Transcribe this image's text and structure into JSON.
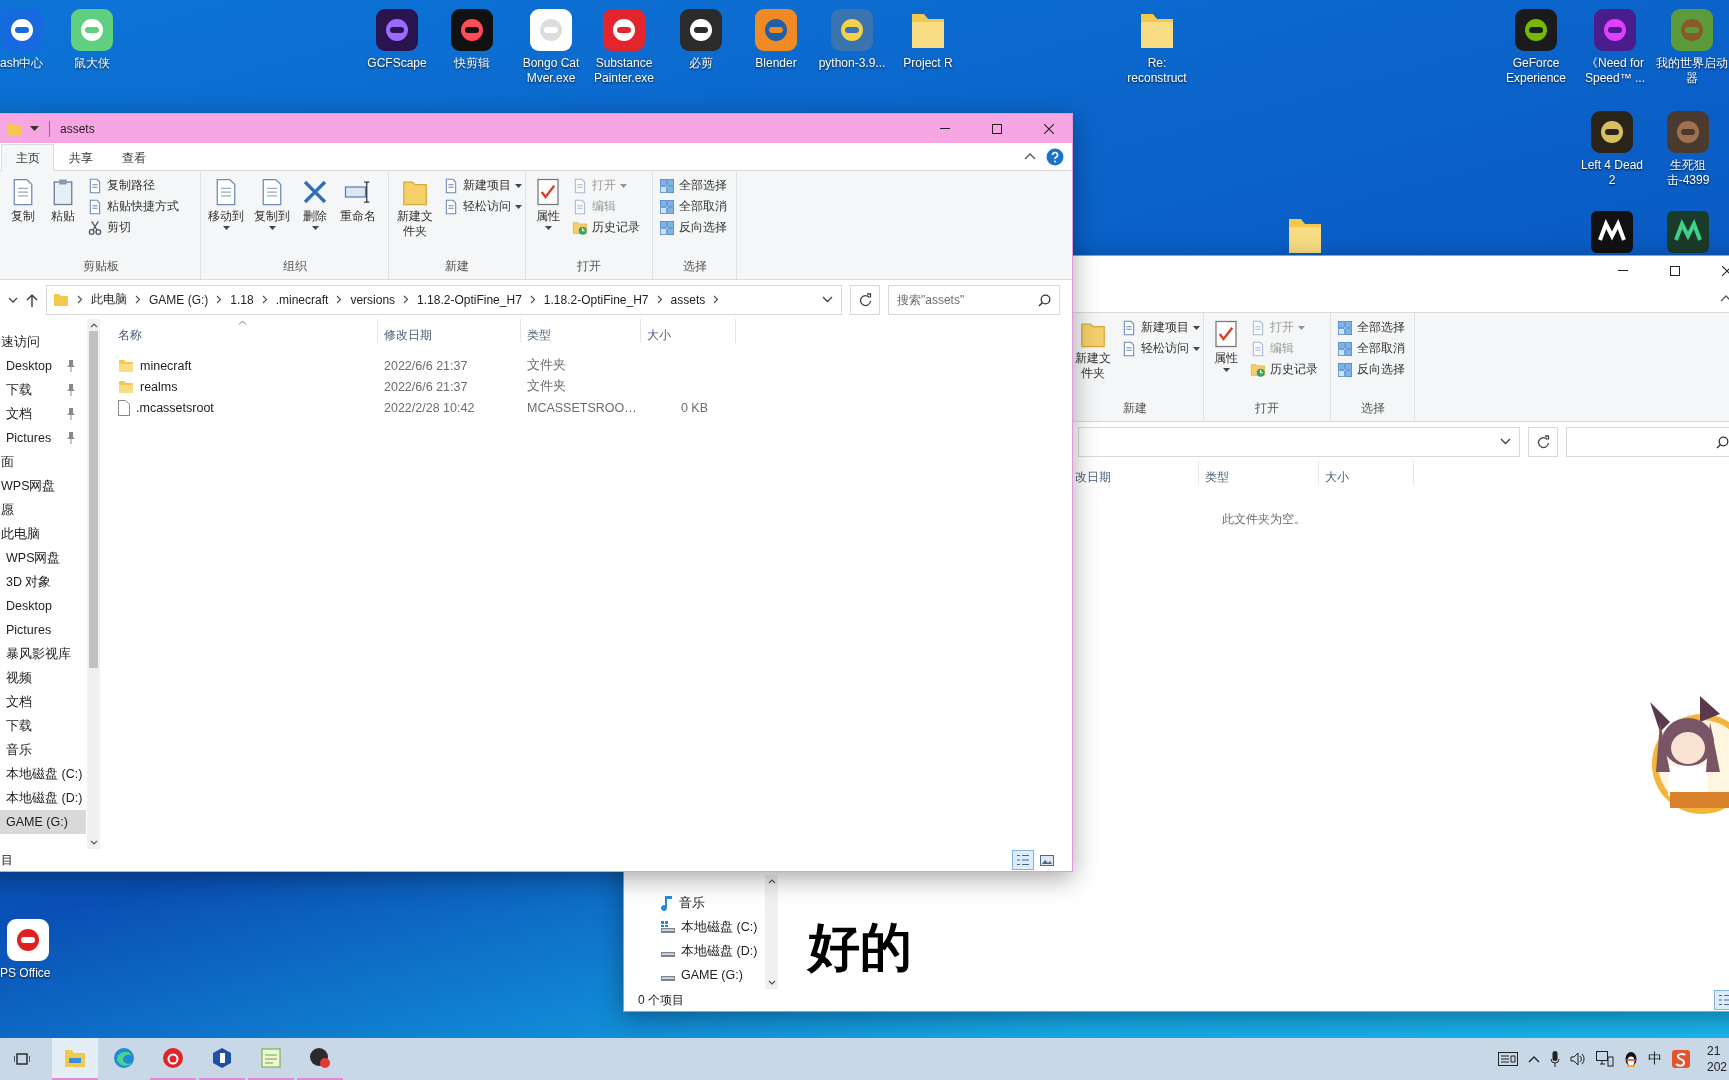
{
  "desktop_icons": [
    {
      "label": "ash中心"
    },
    {
      "label": "鼠大侠"
    },
    {
      "label": "GCFScape"
    },
    {
      "label": "快剪辑"
    },
    {
      "label": "Bongo Cat Mver.exe"
    },
    {
      "label": "Substance Painter.exe"
    },
    {
      "label": "必剪"
    },
    {
      "label": "Blender"
    },
    {
      "label": "python-3.9..."
    },
    {
      "label": "Project R"
    },
    {
      "label": "Re: reconstruct"
    },
    {
      "label": "GeForce Experience"
    },
    {
      "label": "《Need for Speed™ ..."
    },
    {
      "label": "我的世界启动器"
    },
    {
      "label": "Left 4 Dead 2"
    },
    {
      "label": "生死狙击-4399"
    },
    {
      "label": "PS Office"
    }
  ],
  "windows": [
    {
      "active": true,
      "title": "assets",
      "tabs": [
        {
          "label": "主页",
          "selected": true
        },
        {
          "label": "共享",
          "selected": false
        },
        {
          "label": "查看",
          "selected": false
        }
      ],
      "ribbon": [
        {
          "label": "剪贴板",
          "buttons": [
            {
              "kind": "large",
              "label": "复制",
              "caret": false,
              "disabled": false
            },
            {
              "kind": "large",
              "label": "粘贴",
              "caret": false,
              "disabled": false
            },
            {
              "kind": "small",
              "label": "复制路径",
              "caret": false,
              "disabled": false
            },
            {
              "kind": "small",
              "label": "粘贴快捷方式",
              "caret": false,
              "disabled": false
            },
            {
              "kind": "small",
              "label": "剪切",
              "caret": false,
              "disabled": false
            }
          ]
        },
        {
          "label": "组织",
          "buttons": [
            {
              "kind": "large",
              "label": "移动到",
              "caret": true,
              "disabled": false
            },
            {
              "kind": "large",
              "label": "复制到",
              "caret": true,
              "disabled": false
            },
            {
              "kind": "large",
              "label": "删除",
              "caret": true,
              "disabled": false
            },
            {
              "kind": "large",
              "label": "重命名",
              "caret": false,
              "disabled": false
            }
          ]
        },
        {
          "label": "新建",
          "buttons": [
            {
              "kind": "large",
              "label": "新建文件夹",
              "caret": false,
              "disabled": false
            },
            {
              "kind": "small",
              "label": "新建项目",
              "caret": true,
              "disabled": false
            },
            {
              "kind": "small",
              "label": "轻松访问",
              "caret": true,
              "disabled": false
            }
          ]
        },
        {
          "label": "打开",
          "buttons": [
            {
              "kind": "large",
              "label": "属性",
              "caret": true,
              "disabled": false
            },
            {
              "kind": "small",
              "label": "打开",
              "caret": true,
              "disabled": true
            },
            {
              "kind": "small",
              "label": "编辑",
              "caret": false,
              "disabled": true
            },
            {
              "kind": "small",
              "label": "历史记录",
              "caret": false,
              "disabled": false
            }
          ]
        },
        {
          "label": "选择",
          "buttons": [
            {
              "kind": "small",
              "label": "全部选择",
              "caret": false,
              "disabled": false
            },
            {
              "kind": "small",
              "label": "全部取消",
              "caret": false,
              "disabled": false
            },
            {
              "kind": "small",
              "label": "反向选择",
              "caret": false,
              "disabled": false
            }
          ]
        }
      ],
      "address": {
        "crumbs": [
          "此电脑",
          "GAME (G:)",
          "1.18",
          ".minecraft",
          "versions",
          "1.18.2-OptiFine_H7",
          "1.18.2-OptiFine_H7",
          "assets"
        ],
        "search_placeholder": "搜索\"assets\""
      },
      "nav": [
        {
          "label": "速访问",
          "selected": false,
          "children": [
            {
              "label": "Desktop",
              "pinned": true,
              "selected": false
            },
            {
              "label": "下载",
              "pinned": true,
              "selected": false
            },
            {
              "label": "文档",
              "pinned": true,
              "selected": false
            },
            {
              "label": "Pictures",
              "pinned": true,
              "selected": false
            }
          ]
        },
        {
          "label": "面",
          "selected": false
        },
        {
          "label": "WPS网盘",
          "selected": false
        },
        {
          "label": "愿",
          "selected": false
        },
        {
          "label": "此电脑",
          "selected": false,
          "children": [
            {
              "label": "WPS网盘",
              "selected": false
            },
            {
              "label": "3D 对象",
              "selected": false
            },
            {
              "label": "Desktop",
              "selected": false
            },
            {
              "label": "Pictures",
              "selected": false
            },
            {
              "label": "暴风影视库",
              "selected": false
            },
            {
              "label": "视频",
              "selected": false
            },
            {
              "label": "文档",
              "selected": false
            },
            {
              "label": "下载",
              "selected": false
            },
            {
              "label": "音乐",
              "selected": false
            },
            {
              "label": "本地磁盘 (C:)",
              "selected": false
            },
            {
              "label": "本地磁盘 (D:)",
              "selected": false
            },
            {
              "label": "GAME (G:)",
              "selected": true
            }
          ]
        }
      ],
      "columns": [
        {
          "label": "名称",
          "sorted": true
        },
        {
          "label": "修改日期",
          "sorted": false
        },
        {
          "label": "类型",
          "sorted": false
        },
        {
          "label": "大小",
          "sorted": false
        }
      ],
      "files": [
        {
          "kind": "folder",
          "name": "minecraft",
          "modified": "2022/6/6 21:37",
          "type": "文件夹"
        },
        {
          "kind": "folder",
          "name": "realms",
          "modified": "2022/6/6 21:37",
          "type": "文件夹"
        },
        {
          "kind": "file",
          "name": ".mcassetsroot",
          "modified": "2022/2/28 10:42",
          "type": "MCASSETSROO…",
          "size": "0 KB"
        }
      ],
      "status": "目",
      "view_toggles": [
        {
          "selected": true
        },
        {
          "selected": false
        }
      ]
    },
    {
      "active": false,
      "ribbon": [
        {
          "label": "新建",
          "buttons": [
            {
              "kind": "large",
              "label": "新建文件夹",
              "caret": false,
              "disabled": false
            },
            {
              "kind": "small",
              "label": "新建项目",
              "caret": true,
              "disabled": false
            },
            {
              "kind": "small",
              "label": "轻松访问",
              "caret": true,
              "disabled": false
            }
          ]
        },
        {
          "label": "打开",
          "buttons": [
            {
              "kind": "large",
              "label": "属性",
              "caret": true,
              "disabled": false
            },
            {
              "kind": "small",
              "label": "打开",
              "caret": true,
              "disabled": true
            },
            {
              "kind": "small",
              "label": "编辑",
              "caret": false,
              "disabled": true
            },
            {
              "kind": "small",
              "label": "历史记录",
              "caret": false,
              "disabled": false
            }
          ]
        },
        {
          "label": "选择",
          "buttons": [
            {
              "kind": "small",
              "label": "全部选择",
              "caret": false,
              "disabled": false
            },
            {
              "kind": "small",
              "label": "全部取消",
              "caret": false,
              "disabled": false
            },
            {
              "kind": "small",
              "label": "反向选择",
              "caret": false,
              "disabled": false
            }
          ]
        }
      ],
      "nav": [
        {
          "label": "音乐",
          "selected": false
        },
        {
          "label": "本地磁盘 (C:)",
          "selected": false
        },
        {
          "label": "本地磁盘 (D:)",
          "selected": false
        },
        {
          "label": "GAME (G:)",
          "selected": false
        }
      ],
      "columns": [
        {
          "label": "改日期",
          "sorted": false
        },
        {
          "label": "类型",
          "sorted": false
        },
        {
          "label": "大小",
          "sorted": false
        }
      ],
      "empty_message": "此文件夹为空。",
      "status": "0 个项目",
      "view_toggles": [
        {
          "selected": true
        }
      ]
    }
  ],
  "subtitle": "好的",
  "taskbar": {
    "apps": [
      {
        "running": true,
        "selected": true
      },
      {
        "running": false,
        "selected": false
      },
      {
        "running": true,
        "selected": false
      },
      {
        "running": true,
        "selected": false
      },
      {
        "running": true,
        "selected": false
      },
      {
        "running": true,
        "selected": false
      }
    ],
    "ime": "中",
    "clock": {
      "time": "21",
      "date": "202"
    }
  }
}
